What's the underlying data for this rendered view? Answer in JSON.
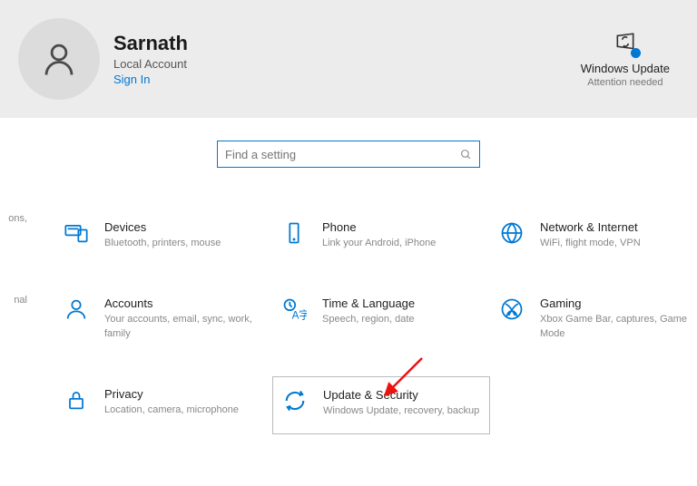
{
  "header": {
    "user_name": "Sarnath",
    "account_type": "Local Account",
    "signin_label": "Sign In",
    "windows_update_title": "Windows Update",
    "windows_update_sub": "Attention needed"
  },
  "search": {
    "placeholder": "Find a setting"
  },
  "edge": {
    "e0": "ons,",
    "e1": "nal"
  },
  "categories": {
    "devices": {
      "title": "Devices",
      "sub": "Bluetooth, printers, mouse"
    },
    "phone": {
      "title": "Phone",
      "sub": "Link your Android, iPhone"
    },
    "network": {
      "title": "Network & Internet",
      "sub": "WiFi, flight mode, VPN"
    },
    "accounts": {
      "title": "Accounts",
      "sub": "Your accounts, email, sync, work, family"
    },
    "time": {
      "title": "Time & Language",
      "sub": "Speech, region, date"
    },
    "gaming": {
      "title": "Gaming",
      "sub": "Xbox Game Bar, captures, Game Mode"
    },
    "privacy": {
      "title": "Privacy",
      "sub": "Location, camera, microphone"
    },
    "update": {
      "title": "Update & Security",
      "sub": "Windows Update, recovery, backup"
    }
  }
}
